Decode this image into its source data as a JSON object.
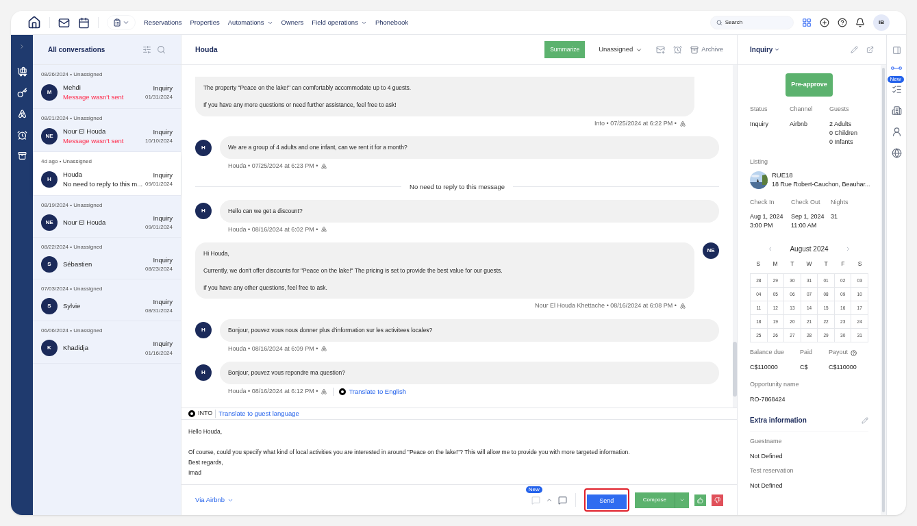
{
  "top_nav": {
    "items": [
      {
        "label": "Reservations",
        "dropdown": false
      },
      {
        "label": "Properties",
        "dropdown": false
      },
      {
        "label": "Automations",
        "dropdown": true
      },
      {
        "label": "Owners",
        "dropdown": false
      },
      {
        "label": "Field operations",
        "dropdown": true
      },
      {
        "label": "Phonebook",
        "dropdown": false
      }
    ],
    "search": {
      "placeholder": "Search"
    },
    "avatar": "IB"
  },
  "conversations": {
    "title": "All conversations",
    "items": [
      {
        "meta": "08/26/2024 • Unassigned",
        "initials": "M",
        "name": "Mehdi",
        "preview": "Message wasn't sent",
        "failed": true,
        "status": "Inquiry",
        "date": "01/31/2024",
        "selected": false
      },
      {
        "meta": "08/21/2024 • Unassigned",
        "initials": "NE",
        "name": "Nour El Houda",
        "preview": "Message wasn't sent",
        "failed": true,
        "status": "Inquiry",
        "date": "10/10/2024",
        "selected": false
      },
      {
        "meta": "4d ago • Unassigned",
        "initials": "H",
        "name": "Houda",
        "preview": "No need to reply to this m...",
        "failed": false,
        "status": "Inquiry",
        "date": "09/01/2024",
        "selected": true
      },
      {
        "meta": "08/19/2024 • Unassigned",
        "initials": "NE",
        "name": "Nour El Houda",
        "status": "Inquiry",
        "date": "09/01/2024",
        "selected": false
      },
      {
        "meta": "08/22/2024 • Unassigned",
        "initials": "S",
        "name": "Sébastien",
        "status": "Inquiry",
        "date": "08/23/2024",
        "selected": false
      },
      {
        "meta": "07/03/2024 • Unassigned",
        "initials": "S",
        "name": "Sylvie",
        "status": "Inquiry",
        "date": "08/31/2024",
        "selected": false
      },
      {
        "meta": "06/06/2024 • Unassigned",
        "initials": "K",
        "name": "Khadidja",
        "status": "Inquiry",
        "date": "01/16/2024",
        "selected": false
      }
    ]
  },
  "chat": {
    "title": "Houda",
    "summarize": "Summarize",
    "assignee": "Unassigned",
    "archive": "Archive",
    "messages": [
      {
        "kind": "host",
        "lines": [
          "The property \"Peace on the lake!\" can comfortably accommodate up to 4 guests.",
          "If you have any more questions or need further assistance, feel free to ask!"
        ],
        "meta": "Into • 07/25/2024 at 6:22 PM •",
        "cut": true
      },
      {
        "kind": "guest",
        "initials": "H",
        "lines": [
          "We are a group of 4 adults and one infant, can we rent it for a month?"
        ],
        "meta": "Houda • 07/25/2024 at 6:23 PM •"
      },
      {
        "kind": "system",
        "text": "No need to reply to this message"
      },
      {
        "kind": "guest",
        "initials": "H",
        "lines": [
          "Hello can we get a discount?"
        ],
        "meta": "Houda • 08/16/2024 at 6:02 PM •"
      },
      {
        "kind": "host",
        "initials": "NE",
        "lines": [
          "Hi Houda,",
          "Currently, we don't offer discounts for \"Peace on the lake!\" The pricing is set to provide the best value for our guests.",
          "If you have any other questions, feel free to ask."
        ],
        "meta": "Nour El Houda Khettache • 08/16/2024 at 6:08 PM •"
      },
      {
        "kind": "guest",
        "initials": "H",
        "lines": [
          "Bonjour, pouvez vous nous donner plus d'information sur les activitees locales?"
        ],
        "meta": "Houda • 08/16/2024 at 6:09 PM •"
      },
      {
        "kind": "guest",
        "initials": "H",
        "lines": [
          "Bonjour, pouvez vous repondre ma question?"
        ],
        "meta": "Houda • 08/16/2024 at 6:12 PM •",
        "translate": "Translate to English"
      }
    ],
    "translator": {
      "label": "INTO",
      "link": "Translate to guest language"
    },
    "draft": "Hello Houda,\n\nOf course, could you specify what kind of local activities you are interested in around \"Peace on the lake!\"? This will allow me to provide you with more targeted information.\nBest regards,\nImad",
    "channel": "Via Airbnb",
    "new_badge": "New",
    "send": "Send",
    "compose": "Compose"
  },
  "details": {
    "title": "Inquiry",
    "preapprove": "Pre-approve",
    "fields": [
      {
        "label": "Status",
        "lines": [
          "Inquiry"
        ]
      },
      {
        "label": "Channel",
        "lines": [
          "Airbnb"
        ]
      },
      {
        "label": "Guests",
        "lines": [
          "2 Adults",
          "0 Children",
          "0 Infants"
        ]
      }
    ],
    "listing": {
      "label": "Listing",
      "name": "RUE18",
      "address": "18 Rue Robert-Cauchon, Beauhar..."
    },
    "stay": [
      {
        "label": "Check In",
        "lines": [
          "Aug 1, 2024",
          "3:00 PM"
        ]
      },
      {
        "label": "Check Out",
        "lines": [
          "Sep 1, 2024",
          "11:00 AM"
        ]
      },
      {
        "label": "Nights",
        "lines": [
          "31"
        ]
      }
    ],
    "calendar": {
      "month": "August 2024",
      "weekdays": [
        "S",
        "M",
        "T",
        "W",
        "T",
        "F",
        "S"
      ],
      "weeks": [
        [
          "28",
          "29",
          "30",
          "31",
          "01",
          "02",
          "03"
        ],
        [
          "04",
          "05",
          "06",
          "07",
          "08",
          "09",
          "10"
        ],
        [
          "11",
          "12",
          "13",
          "14",
          "15",
          "16",
          "17"
        ],
        [
          "18",
          "19",
          "20",
          "21",
          "22",
          "23",
          "24"
        ],
        [
          "25",
          "26",
          "27",
          "28",
          "29",
          "30",
          "31"
        ]
      ]
    },
    "money": [
      {
        "label": "Balance due",
        "value": "C$110000",
        "help": false
      },
      {
        "label": "Paid",
        "value": "C$",
        "help": false
      },
      {
        "label": "Payout",
        "value": "C$110000",
        "help": true
      }
    ],
    "opportunity": {
      "label": "Opportunity name",
      "value": "RO-7868424"
    },
    "extra": {
      "title": "Extra information",
      "fields": [
        {
          "label": "Guestname",
          "value": "Not Defined"
        },
        {
          "label": "Test reservation",
          "value": "Not Defined"
        }
      ]
    }
  },
  "rail_badge": "New"
}
